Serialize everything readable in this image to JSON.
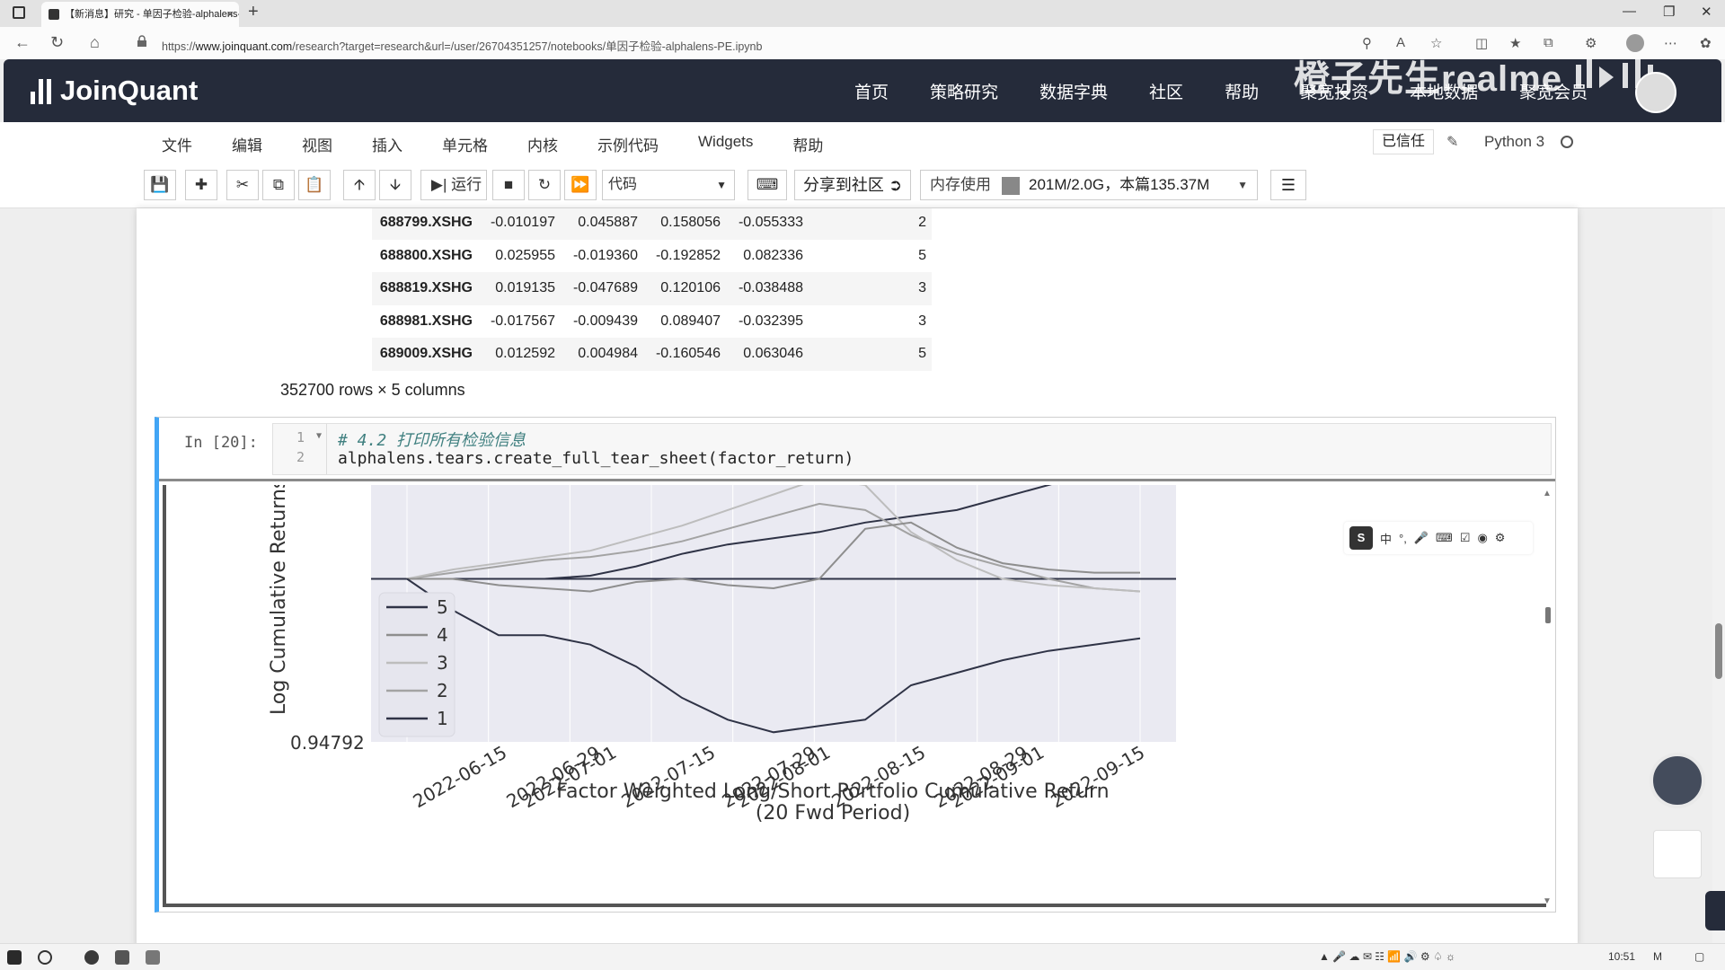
{
  "browser": {
    "tab_title": "【新消息】研究 - 单因子检验-alphalens-PE",
    "url_prefix": "https://",
    "url_domain": "www.joinquant.com",
    "url_path": "/research?target=research&url=/user/26704351257/notebooks/单因子检验-alphalens-PE.ipynb",
    "tab_close": "×",
    "new_tab": "+"
  },
  "site": {
    "logo_text": "JoinQuant",
    "nav": [
      "首页",
      "策略研究",
      "数据字典",
      "社区",
      "帮助",
      "聚宽投资",
      "本地数据",
      "聚宽会员"
    ],
    "watermark": "橙子先生realme"
  },
  "notebook": {
    "menu": [
      "文件",
      "编辑",
      "视图",
      "插入",
      "单元格",
      "内核",
      "示例代码",
      "Widgets",
      "帮助"
    ],
    "trusted_label": "已信任",
    "kernel_name": "Python 3",
    "run_label": "运行",
    "cell_type": "代码",
    "share_label": "分享到社区",
    "memory_label": "内存使用",
    "memory_value": "201M/2.0G，本篇135.37M"
  },
  "dataframe": {
    "rows": [
      {
        "index": "688799.XSHG",
        "values": [
          "-0.010197",
          "0.045887",
          "0.158056",
          "-0.055333"
        ],
        "quantile": "2"
      },
      {
        "index": "688800.XSHG",
        "values": [
          "0.025955",
          "-0.019360",
          "-0.192852",
          "0.082336"
        ],
        "quantile": "5"
      },
      {
        "index": "688819.XSHG",
        "values": [
          "0.019135",
          "-0.047689",
          "0.120106",
          "-0.038488"
        ],
        "quantile": "3"
      },
      {
        "index": "688981.XSHG",
        "values": [
          "-0.017567",
          "-0.009439",
          "0.089407",
          "-0.032395"
        ],
        "quantile": "3"
      },
      {
        "index": "689009.XSHG",
        "values": [
          "0.012592",
          "0.004984",
          "-0.160546",
          "0.063046"
        ],
        "quantile": "5"
      }
    ],
    "caption": "352700 rows × 5 columns"
  },
  "cell": {
    "prompt": "In  [20]:",
    "line_numbers": [
      "1",
      "2"
    ],
    "line1": "# 4.2 打印所有检验信息",
    "line2": "alphalens.tears.create_full_tear_sheet(factor_return)"
  },
  "chart_data": {
    "type": "line",
    "ylabel": "Log Cumulative Returns",
    "title": "Factor Weighted Long/Short Portfolio Cumulative Return",
    "subtitle": "(20 Fwd Period)",
    "y_tick": "0.94792",
    "x_ticks": [
      "2022-06-15",
      "2022-06-29",
      "2022-07-01",
      "2022-07-15",
      "2022-07-29",
      "2022-08-01",
      "2022-08-15",
      "2022-08-29",
      "2022-09-01",
      "2022-09-15"
    ],
    "x_tick_overlaps": [
      "2022-06-15",
      "2022-06-29",
      "2022-07-01",
      "2022-07-15",
      "2022-07-29",
      "2022-08-01",
      "2022-08-15",
      "2022-08-29",
      "2022-09-01",
      "2022-09-15"
    ],
    "legend": [
      "5",
      "4",
      "3",
      "2",
      "1"
    ],
    "legend_placement": "lower-left",
    "baseline": 1.0,
    "colors": {
      "5": "#2f3346",
      "4": "#8e8e8e",
      "3": "#bdbdbd",
      "2": "#a3a3a3",
      "1": "#2f3346"
    },
    "series": [
      {
        "name": "1",
        "values": [
          1.0,
          1.0,
          1.0,
          1.0,
          1.001,
          1.004,
          1.008,
          1.011,
          1.013,
          1.015,
          1.018,
          1.02,
          1.022,
          1.026,
          1.03,
          1.034,
          1.036
        ]
      },
      {
        "name": "2",
        "values": [
          1.0,
          1.002,
          1.004,
          1.006,
          1.007,
          1.009,
          1.012,
          1.016,
          1.02,
          1.024,
          1.022,
          1.014,
          1.008,
          1.004,
          1.0,
          0.997,
          0.996
        ]
      },
      {
        "name": "3",
        "values": [
          1.0,
          1.003,
          1.005,
          1.007,
          1.009,
          1.013,
          1.017,
          1.022,
          1.027,
          1.032,
          1.03,
          1.015,
          1.006,
          1.0,
          0.998,
          0.997,
          0.996
        ]
      },
      {
        "name": "4",
        "values": [
          1.0,
          1.0,
          0.998,
          0.997,
          0.996,
          0.999,
          1.0,
          0.998,
          0.997,
          1.0,
          1.016,
          1.018,
          1.01,
          1.005,
          1.003,
          1.002,
          1.002
        ]
      },
      {
        "name": "5",
        "values": [
          1.0,
          0.99,
          0.982,
          0.982,
          0.979,
          0.972,
          0.962,
          0.955,
          0.951,
          0.953,
          0.955,
          0.966,
          0.97,
          0.974,
          0.977,
          0.979,
          0.981
        ]
      }
    ],
    "ylim": [
      0.94792,
      1.03
    ]
  },
  "ime": {
    "logo": "S",
    "label": "中"
  },
  "taskbar": {
    "time": "10:51"
  }
}
